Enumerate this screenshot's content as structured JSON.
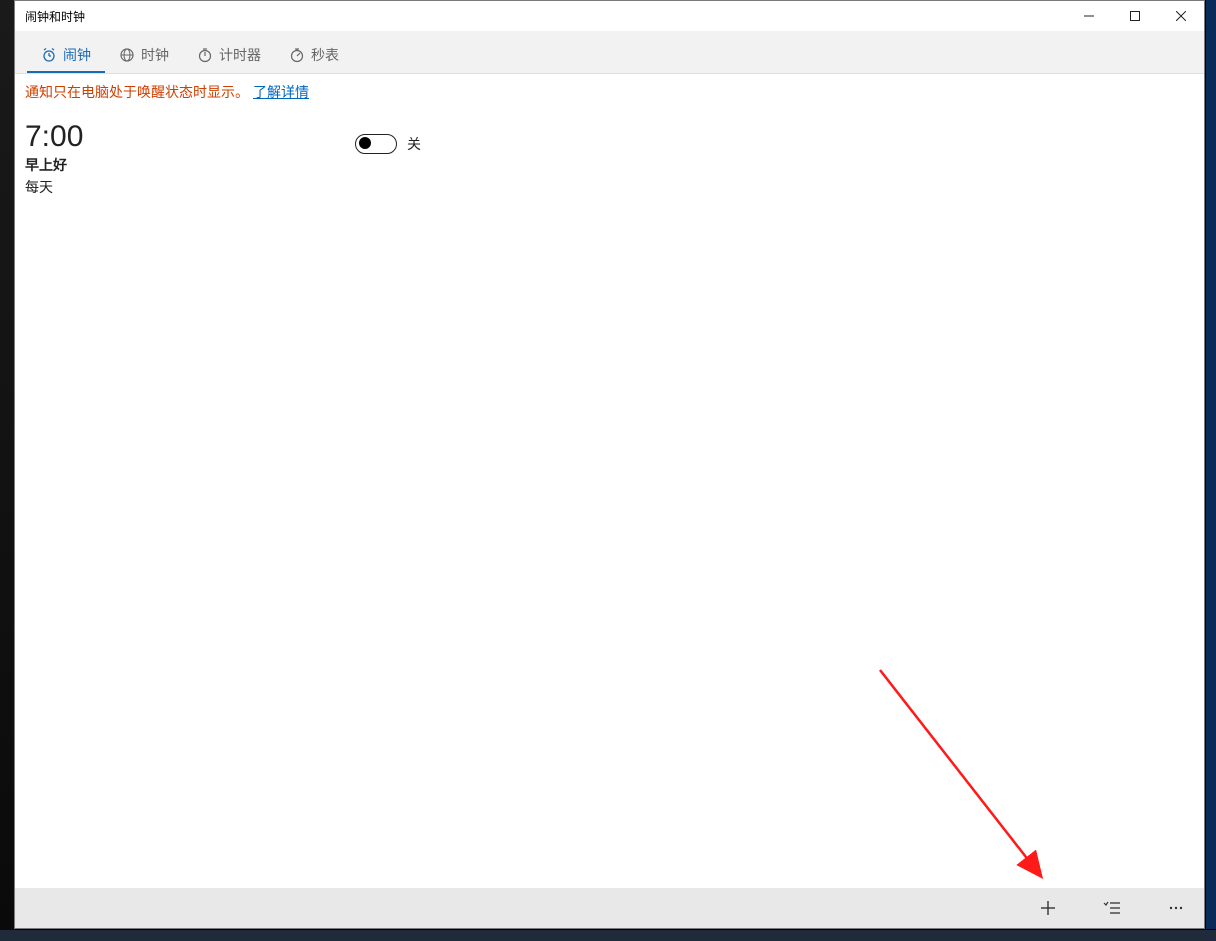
{
  "window": {
    "title": "闹钟和时钟"
  },
  "tabs": [
    {
      "label": "闹钟",
      "active": true
    },
    {
      "label": "时钟",
      "active": false
    },
    {
      "label": "计时器",
      "active": false
    },
    {
      "label": "秒表",
      "active": false
    }
  ],
  "notice": {
    "text": "通知只在电脑处于唤醒状态时显示。",
    "link_label": "了解详情"
  },
  "alarm": {
    "time": "7:00",
    "name": "早上好",
    "repeat": "每天",
    "toggle_state_label": "关"
  }
}
